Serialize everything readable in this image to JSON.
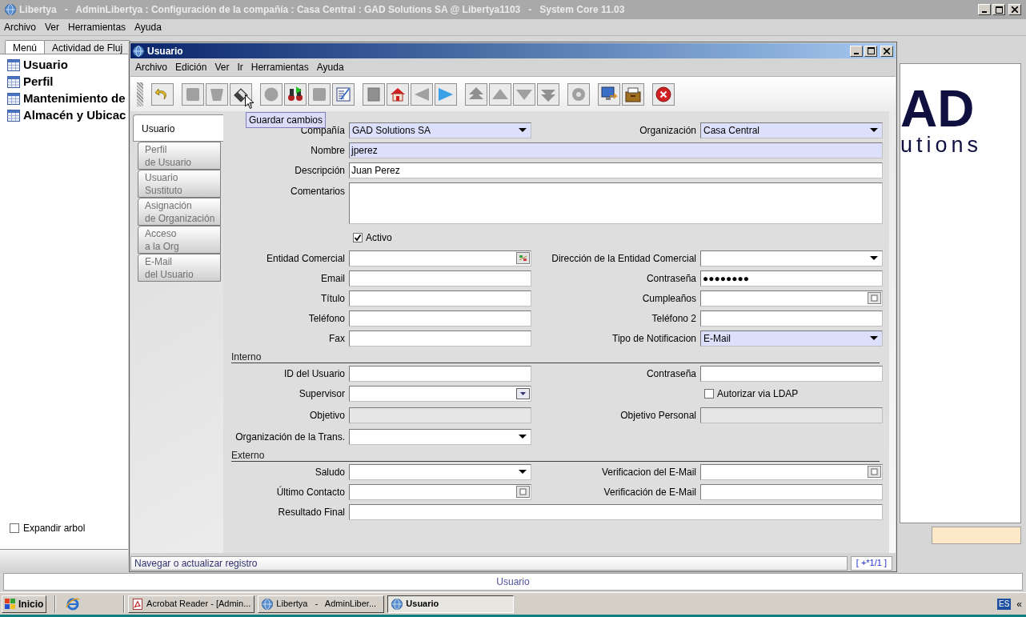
{
  "main_window": {
    "title": "Libertya   -   AdminLibertya : Configuración de la compañía : Casa Central : GAD Solutions SA @ Libertya1103   -   System Core 11.03",
    "menu": [
      "Archivo",
      "Ver",
      "Herramientas",
      "Ayuda"
    ],
    "tabs": [
      {
        "label": "Menú",
        "selected": true
      },
      {
        "label": "Actividad de Fluj",
        "selected": false
      }
    ],
    "tree": [
      "Usuario",
      "Perfil",
      "Mantenimiento de",
      "Almacén y Ubicac"
    ],
    "logo": [
      "AD",
      "utions"
    ],
    "expand_tree": {
      "label": "Expandir arbol",
      "checked": false
    },
    "status": "Usuario"
  },
  "window": {
    "title": "Usuario",
    "menu": [
      "Archivo",
      "Edición",
      "Ver",
      "Ir",
      "Herramientas",
      "Ayuda"
    ],
    "tooltip": "Guardar cambios",
    "tabs": [
      {
        "label": "Usuario",
        "selected": true
      },
      {
        "label": "Perfil\nde Usuario",
        "selected": false
      },
      {
        "label": "Usuario\nSustituto",
        "selected": false
      },
      {
        "label": "Asignación\nde Organización",
        "selected": false
      },
      {
        "label": "Acceso\na la Org",
        "selected": false
      },
      {
        "label": "E-Mail\ndel Usuario",
        "selected": false
      }
    ],
    "form": {
      "rows": [
        {
          "kind": "pair",
          "left": {
            "label": "Compañía",
            "kind": "combo",
            "value": "GAD Solutions SA",
            "mandatory": true
          },
          "right": {
            "label": "Organización",
            "kind": "combo",
            "value": "Casa Central",
            "mandatory": true
          }
        },
        {
          "kind": "wide",
          "field": {
            "label": "Nombre",
            "kind": "text",
            "value": "jperez",
            "mandatory": true
          }
        },
        {
          "kind": "wide",
          "field": {
            "label": "Descripción",
            "kind": "text",
            "value": "Juan Perez",
            "mandatory": false
          }
        },
        {
          "kind": "wide",
          "field": {
            "label": "Comentarios",
            "kind": "textarea",
            "mandatory": false
          }
        },
        {
          "kind": "pair",
          "left": {
            "label": "Activo",
            "kind": "checkbox",
            "checked": true
          }
        },
        {
          "kind": "pair",
          "left": {
            "label": "Entidad Comercial",
            "kind": "lookup",
            "mandatory": false
          },
          "right": {
            "label": "Dirección de la Entidad Comercial",
            "kind": "combo",
            "mandatory": false
          }
        },
        {
          "kind": "pair",
          "left": {
            "label": "Email",
            "kind": "text",
            "mandatory": false
          },
          "right": {
            "label": "Contraseña",
            "kind": "text",
            "value": "●●●●●●●●",
            "mandatory": false
          }
        },
        {
          "kind": "pair",
          "left": {
            "label": "Título",
            "kind": "text",
            "mandatory": false
          },
          "right": {
            "label": "Cumpleaños",
            "kind": "date",
            "mandatory": false
          }
        },
        {
          "kind": "pair",
          "left": {
            "label": "Teléfono",
            "kind": "text",
            "mandatory": false
          },
          "right": {
            "label": "Teléfono 2",
            "kind": "text",
            "mandatory": false
          }
        },
        {
          "kind": "pair",
          "left": {
            "label": "Fax",
            "kind": "text",
            "mandatory": false
          },
          "right": {
            "label": "Tipo de Notificacion",
            "kind": "combo",
            "value": "E-Mail",
            "mandatory": true
          }
        },
        {
          "kind": "section",
          "title": "Interno"
        },
        {
          "kind": "pair",
          "left": {
            "label": "ID del Usuario",
            "kind": "text",
            "mandatory": false
          },
          "right": {
            "label": "Contraseña",
            "kind": "text",
            "mandatory": false
          }
        },
        {
          "kind": "pair",
          "left": {
            "label": "Supervisor",
            "kind": "search",
            "mandatory": false
          },
          "right": {
            "label": "Autorizar via LDAP",
            "kind": "checkbox",
            "checked": false
          }
        },
        {
          "kind": "pair",
          "left": {
            "label": "Objetivo",
            "kind": "readonly"
          },
          "right": {
            "label": "Objetivo Personal",
            "kind": "readonly"
          }
        },
        {
          "kind": "pair",
          "left": {
            "label": "Organización de la Trans.",
            "kind": "combo",
            "mandatory": false
          }
        },
        {
          "kind": "section",
          "title": "Externo"
        },
        {
          "kind": "pair",
          "left": {
            "label": "Saludo",
            "kind": "combo",
            "mandatory": false
          },
          "right": {
            "label": "Verificacion del E-Mail",
            "kind": "date",
            "mandatory": false
          }
        },
        {
          "kind": "pair",
          "left": {
            "label": "Último Contacto",
            "kind": "date",
            "mandatory": false
          },
          "right": {
            "label": "Verificación de E-Mail",
            "kind": "text",
            "mandatory": false
          }
        },
        {
          "kind": "wide",
          "field": {
            "label": "Resultado Final",
            "kind": "text",
            "mandatory": false
          }
        }
      ]
    },
    "status": "Navegar o actualizar registro",
    "record": "[ +*1/1 ]"
  },
  "taskbar": {
    "start": "Inicio",
    "tasks": [
      {
        "label": "Acrobat Reader - [Admin...",
        "kind": "pdf",
        "selected": false
      },
      {
        "label": "Libertya   -   AdminLiber...",
        "kind": "app",
        "selected": false
      },
      {
        "label": "Usuario",
        "kind": "app",
        "selected": true
      }
    ],
    "language": "ES",
    "chevron": "«"
  }
}
